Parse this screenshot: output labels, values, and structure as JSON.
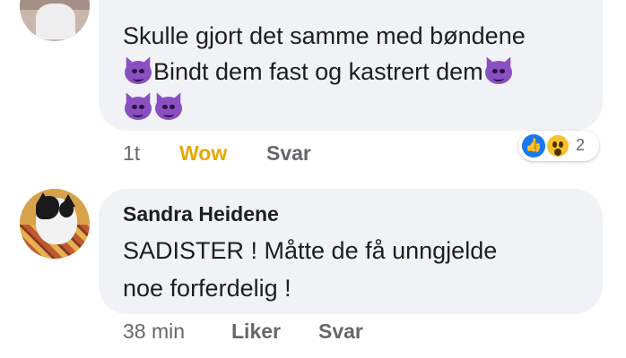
{
  "comments": [
    {
      "text_line1": "Skulle gjort det samme med bøndene",
      "text_line2": "Bindt dem fast og kastrert dem",
      "emojis": "smiling-devil-emoji",
      "time": "1t",
      "reaction_label": "Wow",
      "reply_label": "Svar",
      "reaction_count": "2",
      "reaction_colors": {
        "wow_label": "#e6a700",
        "like": "#1877f2",
        "wow": "#f7c22c",
        "devil": "#8a4fc1"
      }
    },
    {
      "author": "Sandra Heidene",
      "text_line1": "SADISTER ! Måtte de få unngjelde",
      "text_line2": "noe forferdelig !",
      "time": "38 min",
      "like_label": "Liker",
      "reply_label": "Svar"
    }
  ],
  "colors": {
    "bubble": "#f0f2f5",
    "text": "#1c1e21",
    "meta": "#65676b"
  }
}
